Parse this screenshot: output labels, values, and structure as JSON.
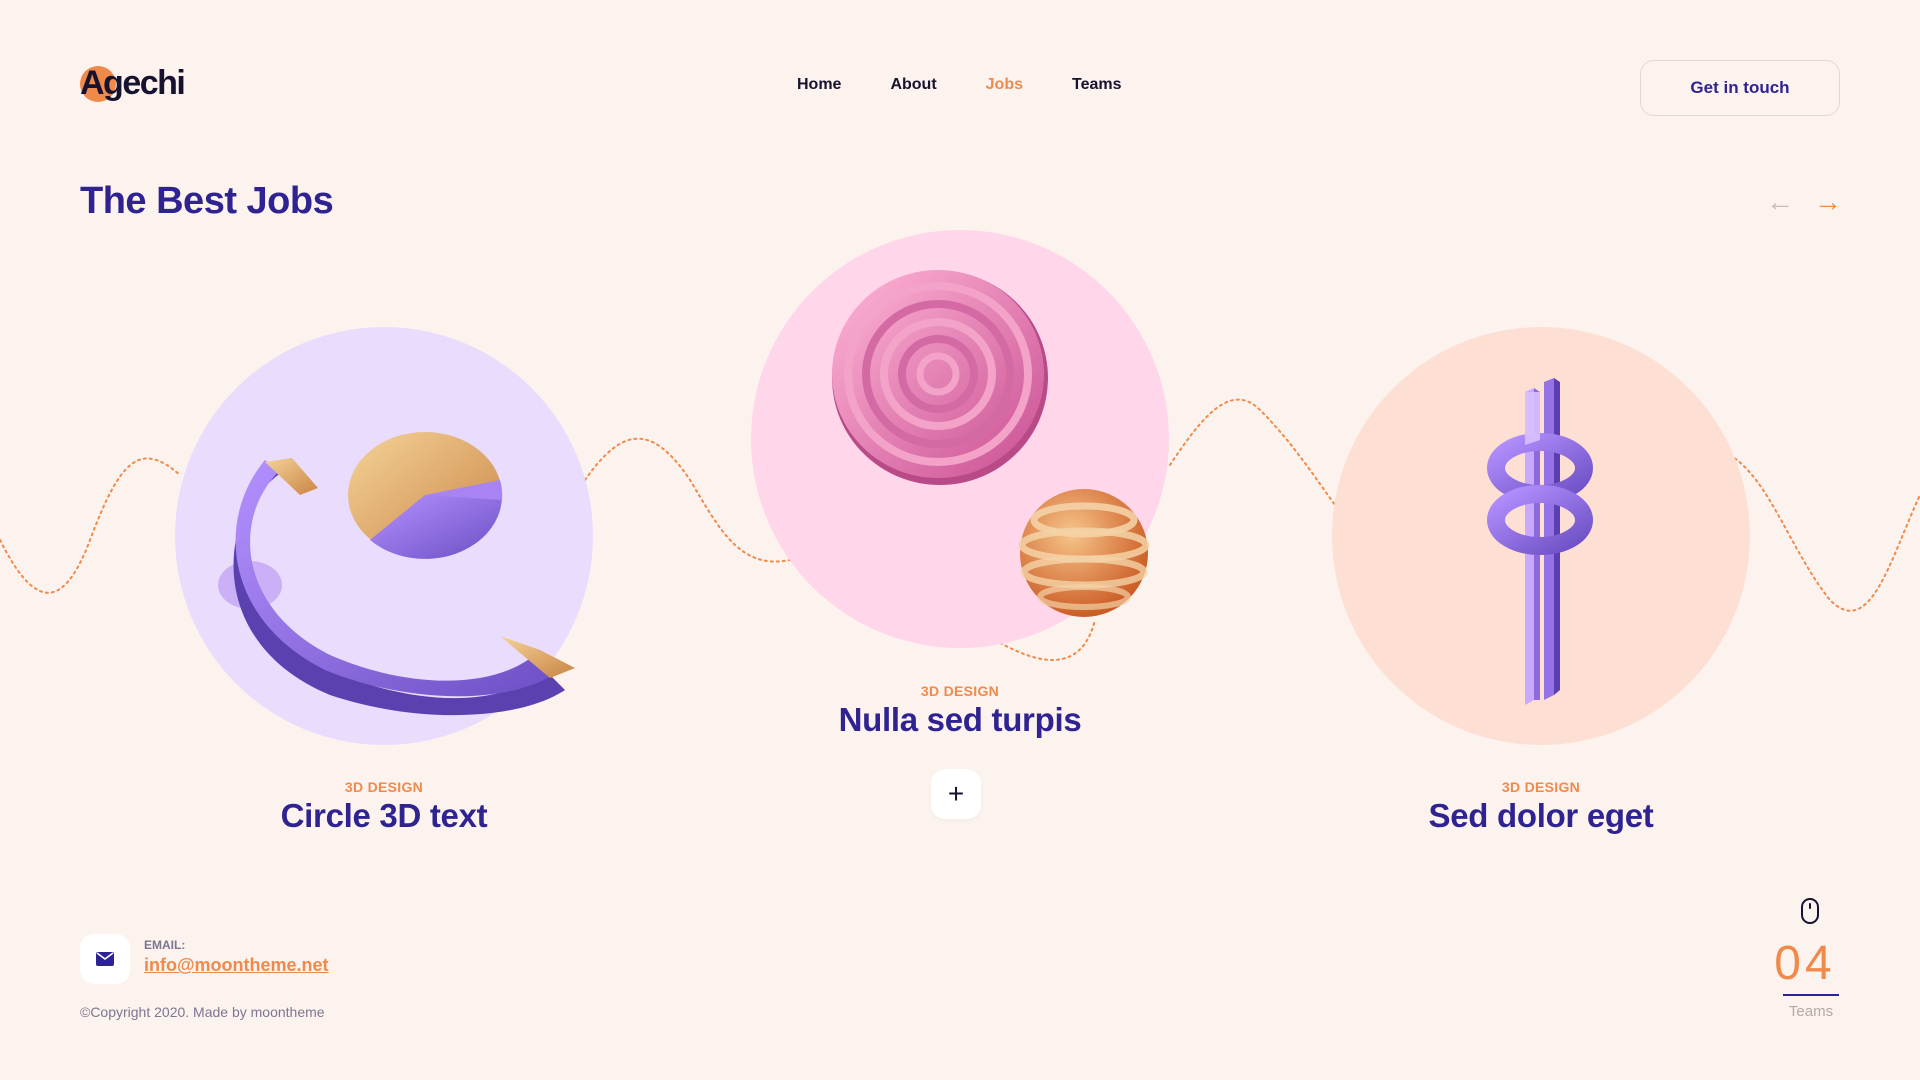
{
  "header": {
    "logo_text": "Agechi",
    "nav": [
      {
        "label": "Home",
        "active": false
      },
      {
        "label": "About",
        "active": false
      },
      {
        "label": "Jobs",
        "active": true
      },
      {
        "label": "Teams",
        "active": false
      }
    ],
    "cta_label": "Get in touch"
  },
  "main": {
    "title": "The Best Jobs",
    "prev_arrow": "←",
    "next_arrow": "→",
    "cards": [
      {
        "category": "3D DESIGN",
        "title": "Circle 3D text",
        "circle_color": "#e9dcfc"
      },
      {
        "category": "3D DESIGN",
        "title": "Nulla sed turpis",
        "circle_color": "#ffd6ea"
      },
      {
        "category": "3D DESIGN",
        "title": "Sed dolor eget",
        "circle_color": "#fde0d3"
      }
    ],
    "plus_label": "+"
  },
  "footer": {
    "email_label": "EMAIL:",
    "email": "info@moontheme.net",
    "copyright": "©Copyright 2020. Made by moontheme",
    "counter_value": "04",
    "counter_label": "Teams"
  },
  "colors": {
    "background": "#fcf3ef",
    "primary": "#2f2391",
    "accent": "#f08a4b"
  },
  "icons": [
    "mail-icon",
    "mouse-scroll-icon",
    "arrow-left-icon",
    "arrow-right-icon",
    "plus-icon"
  ]
}
